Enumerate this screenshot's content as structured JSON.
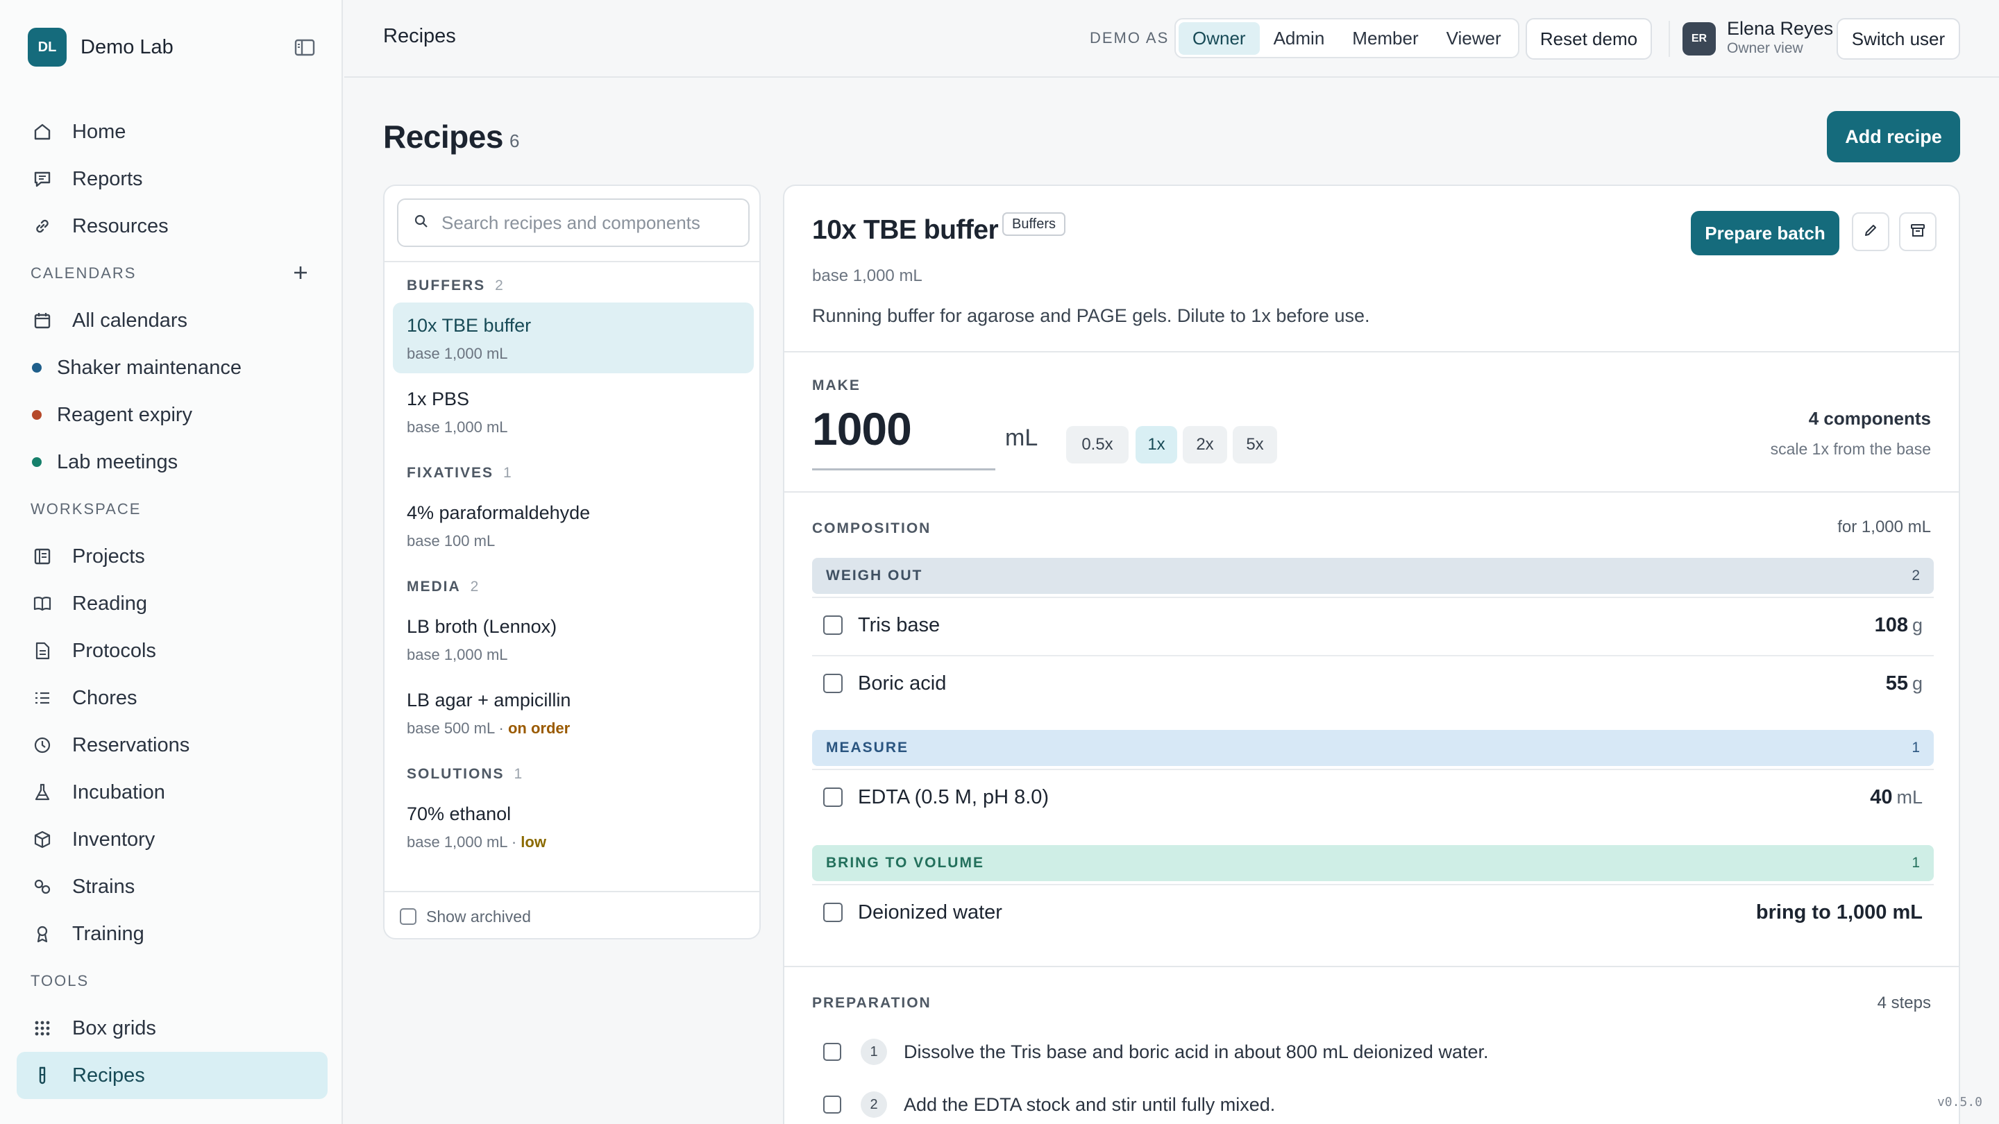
{
  "brand": {
    "initials": "DL",
    "name": "Demo Lab"
  },
  "nav": {
    "main": [
      {
        "label": "Home",
        "icon": "home-icon"
      },
      {
        "label": "Reports",
        "icon": "message-icon"
      },
      {
        "label": "Resources",
        "icon": "link-icon"
      }
    ],
    "calendars_label": "CALENDARS",
    "calendars": [
      {
        "label": "All calendars",
        "icon": "calendar-icon"
      },
      {
        "label": "Shaker maintenance",
        "color": "#1f5f8b"
      },
      {
        "label": "Reagent expiry",
        "color": "#b5492a"
      },
      {
        "label": "Lab meetings",
        "color": "#16806b"
      }
    ],
    "workspace_label": "WORKSPACE",
    "workspace": [
      {
        "label": "Projects",
        "icon": "projects-icon"
      },
      {
        "label": "Reading",
        "icon": "book-icon"
      },
      {
        "label": "Protocols",
        "icon": "document-icon"
      },
      {
        "label": "Chores",
        "icon": "checklist-icon"
      },
      {
        "label": "Reservations",
        "icon": "clock-icon"
      },
      {
        "label": "Incubation",
        "icon": "flask-icon"
      },
      {
        "label": "Inventory",
        "icon": "box-icon"
      },
      {
        "label": "Strains",
        "icon": "strains-icon"
      },
      {
        "label": "Training",
        "icon": "award-icon"
      }
    ],
    "tools_label": "TOOLS",
    "tools": [
      {
        "label": "Box grids",
        "icon": "grid-icon"
      },
      {
        "label": "Recipes",
        "icon": "test-tube-icon",
        "active": true
      }
    ]
  },
  "topbar": {
    "title": "Recipes",
    "demo_as": "DEMO AS",
    "roles": [
      "Owner",
      "Admin",
      "Member",
      "Viewer"
    ],
    "active_role": "Owner",
    "reset": "Reset demo",
    "user": {
      "initials": "ER",
      "name": "Elena Reyes",
      "role": "Owner view"
    },
    "switch": "Switch user"
  },
  "page": {
    "title": "Recipes",
    "count": "6",
    "add": "Add recipe"
  },
  "list": {
    "search_placeholder": "Search recipes and components",
    "groups": [
      {
        "name": "BUFFERS",
        "count": "2",
        "items": [
          {
            "name": "10x TBE buffer",
            "base": "base 1,000 mL",
            "active": true
          },
          {
            "name": "1x PBS",
            "base": "base 1,000 mL"
          }
        ]
      },
      {
        "name": "FIXATIVES",
        "count": "1",
        "items": [
          {
            "name": "4% paraformaldehyde",
            "base": "base 100 mL"
          }
        ]
      },
      {
        "name": "MEDIA",
        "count": "2",
        "items": [
          {
            "name": "LB broth (Lennox)",
            "base": "base 1,000 mL"
          },
          {
            "name": "LB agar + ampicillin",
            "base": "base 500 mL",
            "sep": " · ",
            "flag": "on order",
            "flag_kind": "order"
          }
        ]
      },
      {
        "name": "SOLUTIONS",
        "count": "1",
        "items": [
          {
            "name": "70% ethanol",
            "base": "base 1,000 mL",
            "sep": " · ",
            "flag": "low",
            "flag_kind": "low"
          }
        ]
      }
    ],
    "show_archived": "Show archived"
  },
  "detail": {
    "title": "10x TBE buffer",
    "tag": "Buffers",
    "base": "base 1,000 mL",
    "description": "Running buffer for agarose and PAGE gels. Dilute to 1x before use.",
    "prepare": "Prepare batch",
    "make_label": "MAKE",
    "make_value": "1000",
    "unit": "mL",
    "scales": [
      "0.5x",
      "1x",
      "2x",
      "5x"
    ],
    "active_scale": "1x",
    "components_count": "4 components",
    "scale_note": "scale 1x from the base",
    "composition_label": "COMPOSITION",
    "composition_for": "for 1,000 mL",
    "bands": {
      "weigh": {
        "label": "WEIGH OUT",
        "count": "2"
      },
      "measure": {
        "label": "MEASURE",
        "count": "1"
      },
      "volume": {
        "label": "BRING TO VOLUME",
        "count": "1"
      }
    },
    "components": [
      {
        "name": "Tris base",
        "amount": "108",
        "unit": "g"
      },
      {
        "name": "Boric acid",
        "amount": "55",
        "unit": "g"
      },
      {
        "name": "EDTA (0.5 M, pH 8.0)",
        "amount": "40",
        "unit": "mL"
      },
      {
        "name": "Deionized water",
        "amount": "bring to 1,000 mL",
        "unit": ""
      }
    ],
    "preparation_label": "PREPARATION",
    "steps_count": "4 steps",
    "steps": [
      {
        "n": "1",
        "text": "Dissolve the Tris base and boric acid in about 800 mL deionized water."
      },
      {
        "n": "2",
        "text": "Add the EDTA stock and stir until fully mixed."
      }
    ]
  },
  "version": "v0.5.0",
  "colors": {
    "accent": "#156b7c",
    "active_bg": "#dff0f4"
  }
}
